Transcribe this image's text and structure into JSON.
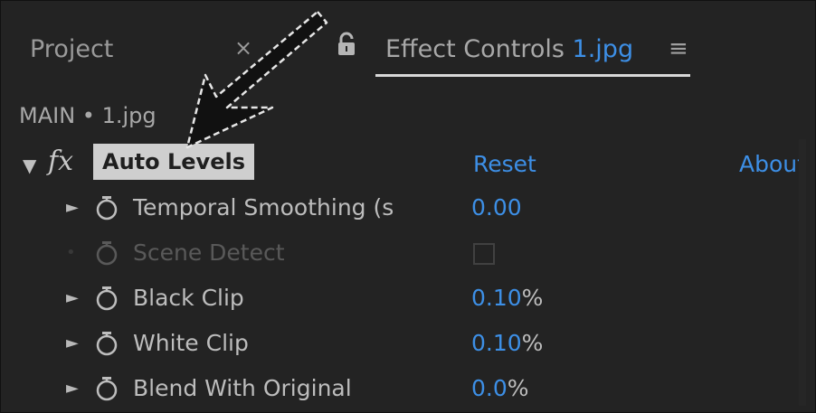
{
  "tabs": {
    "project_label": "Project",
    "close_symbol": "×",
    "effect_controls_label": "Effect Controls",
    "effect_controls_file": "1.jpg",
    "menu_symbol": "≡"
  },
  "breadcrumb": "MAIN • 1.jpg",
  "effect": {
    "fx_symbol": "fx",
    "name": "Auto Levels",
    "reset_label": "Reset",
    "about_label": "About"
  },
  "properties": [
    {
      "label": "Temporal Smoothing (s",
      "value": "0.00",
      "unit": ""
    },
    {
      "label": "Scene Detect",
      "value": "",
      "unit": "",
      "enabled": false
    },
    {
      "label": "Black Clip",
      "value": "0.10",
      "unit": "%"
    },
    {
      "label": "White Clip",
      "value": "0.10",
      "unit": "%"
    },
    {
      "label": "Blend With Original",
      "value": "0.0",
      "unit": "%"
    }
  ],
  "icons": {
    "lock": "lock-icon",
    "stopwatch": "stopwatch-icon",
    "expand": "triangle-right-icon",
    "collapse": "triangle-down-icon",
    "annotation": "pointer-arrow-annotation"
  },
  "colors": {
    "panel_bg": "#232323",
    "accent_blue": "#3d8fe6",
    "text_gray": "#bdbdbd",
    "highlight": "#cfcfcf"
  }
}
